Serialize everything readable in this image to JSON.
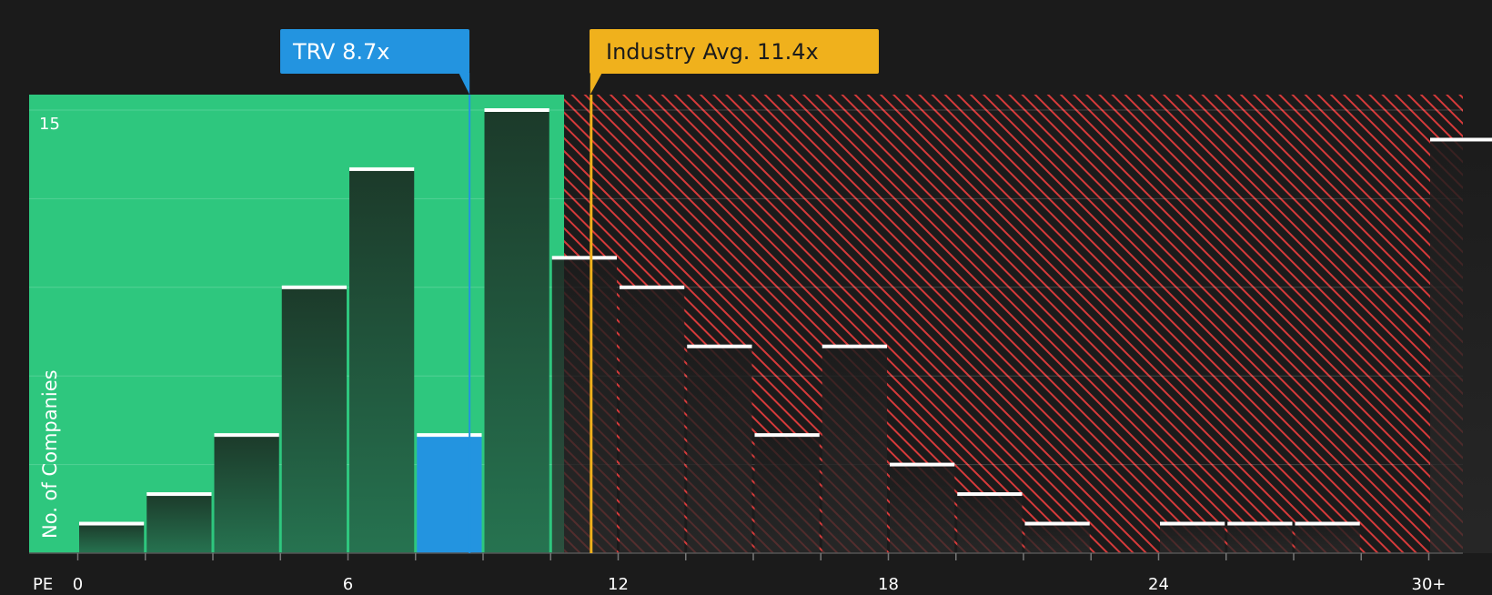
{
  "chart_data": {
    "type": "bar",
    "x_axis_label": "PE",
    "ylabel": "No. of Companies",
    "x_tick_labels": [
      "0",
      "6",
      "12",
      "18",
      "24",
      "30+"
    ],
    "x_tick_values": [
      0,
      6,
      12,
      18,
      24,
      30
    ],
    "y_tick_labels": [
      "15"
    ],
    "y_tick_values": [
      15
    ],
    "ylim": [
      0,
      15.5
    ],
    "bin_width": 1.5,
    "bins": [
      {
        "start": 0,
        "end": 1.5,
        "count": 1
      },
      {
        "start": 1.5,
        "end": 3,
        "count": 2
      },
      {
        "start": 3,
        "end": 4.5,
        "count": 4
      },
      {
        "start": 4.5,
        "end": 6,
        "count": 9
      },
      {
        "start": 6,
        "end": 7.5,
        "count": 13
      },
      {
        "start": 7.5,
        "end": 9,
        "count": 4,
        "highlight": true
      },
      {
        "start": 9,
        "end": 10.5,
        "count": 15
      },
      {
        "start": 10.5,
        "end": 12,
        "count": 10
      },
      {
        "start": 12,
        "end": 13.5,
        "count": 9
      },
      {
        "start": 13.5,
        "end": 15,
        "count": 7
      },
      {
        "start": 15,
        "end": 16.5,
        "count": 4
      },
      {
        "start": 16.5,
        "end": 18,
        "count": 7
      },
      {
        "start": 18,
        "end": 19.5,
        "count": 3
      },
      {
        "start": 19.5,
        "end": 21,
        "count": 2
      },
      {
        "start": 21,
        "end": 22.5,
        "count": 1
      },
      {
        "start": 22.5,
        "end": 24,
        "count": 0
      },
      {
        "start": 24,
        "end": 25.5,
        "count": 1
      },
      {
        "start": 25.5,
        "end": 27,
        "count": 1
      },
      {
        "start": 27,
        "end": 28.5,
        "count": 1
      },
      {
        "start": 28.5,
        "end": 30,
        "count": 0
      },
      {
        "start": 30,
        "end": 31.5,
        "count": 14
      }
    ],
    "company": {
      "label": "TRV 8.7x",
      "value": 8.7,
      "color": "#2394e0"
    },
    "industry": {
      "label": "Industry Avg. 11.4x",
      "value": 11.4,
      "color": "#f0b11c"
    },
    "regions": {
      "good_color": "#2ec77e",
      "bad_color": "#d63a3a"
    },
    "grid": true,
    "colors": {
      "bar": "#1f4030",
      "bar_highlight": "#2394e0",
      "bar_cap": "#ffffff",
      "background": "#1b1b1b"
    }
  }
}
